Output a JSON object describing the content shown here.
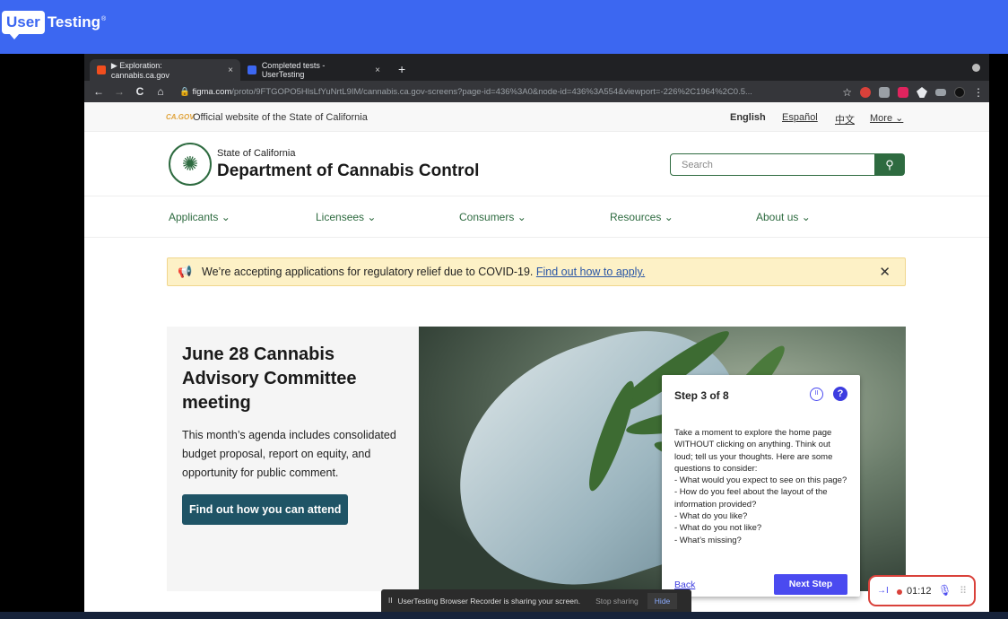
{
  "ut": {
    "logo_box": "User",
    "logo_text": "Testing",
    "logo_tm": "®"
  },
  "browser": {
    "tabs": [
      {
        "label": "▶ Exploration: cannabis.ca.gov",
        "close": "×"
      },
      {
        "label": "Completed tests - UserTesting",
        "close": "×"
      }
    ],
    "new_tab": "+",
    "nav": {
      "back": "←",
      "forward": "→",
      "reload": "C",
      "home": "⌂"
    },
    "url_host": "figma.com",
    "url_path": "/proto/9FTGOPO5HlsLfYuNrtL9IM/cannabis.ca.gov-screens?page-id=436%3A0&node-id=436%3A554&viewport=-226%2C1964%2C0.5..."
  },
  "govbar": {
    "logo": "CA.GOV",
    "text": "Official website of the State of California",
    "langs": [
      "English",
      "Español",
      "中文",
      "More ⌄"
    ]
  },
  "header": {
    "seal_glyph": "✺",
    "state": "State of California",
    "dept": "Department of Cannabis Control",
    "search_placeholder": "Search",
    "search_icon": "⚲"
  },
  "nav_items": [
    "Applicants ⌄",
    "Licensees ⌄",
    "Consumers ⌄",
    "Resources ⌄",
    "About us ⌄"
  ],
  "alert": {
    "icon": "📢",
    "text": "We’re accepting applications for regulatory relief due to COVID-19. ",
    "link": "Find out how to apply.",
    "close": "✕"
  },
  "hero": {
    "title": "June 28 Cannabis Advisory Committee meeting",
    "body": "This month’s agenda includes consolidated budget proposal, report on equity, and opportunity for public comment.",
    "button": "Find out how you can attend"
  },
  "step": {
    "title": "Step 3 of 8",
    "pause": "II",
    "help": "?",
    "body": "Take a moment to explore the home page WITHOUT clicking on anything. Think out loud; tell us your thoughts. Here are some questions to consider:\n- What would you expect to see on this page?\n- How do you feel about the layout of the information provided?\n- What do you like?\n- What do you not like?\n- What’s missing?",
    "back": "Back",
    "next": "Next Step"
  },
  "share": {
    "pause": "II",
    "text": "UserTesting Browser Recorder is sharing your screen.",
    "stop": "Stop sharing",
    "hide": "Hide"
  },
  "recorder": {
    "in_icon": "→I",
    "time": "01:12",
    "mic": "🎙",
    "grip": "⠿"
  },
  "colors": {
    "ut_blue": "#3c67f1",
    "ca_green": "#2e6b40",
    "step_purple": "#4a4af0",
    "rec_red": "#d9413a"
  }
}
